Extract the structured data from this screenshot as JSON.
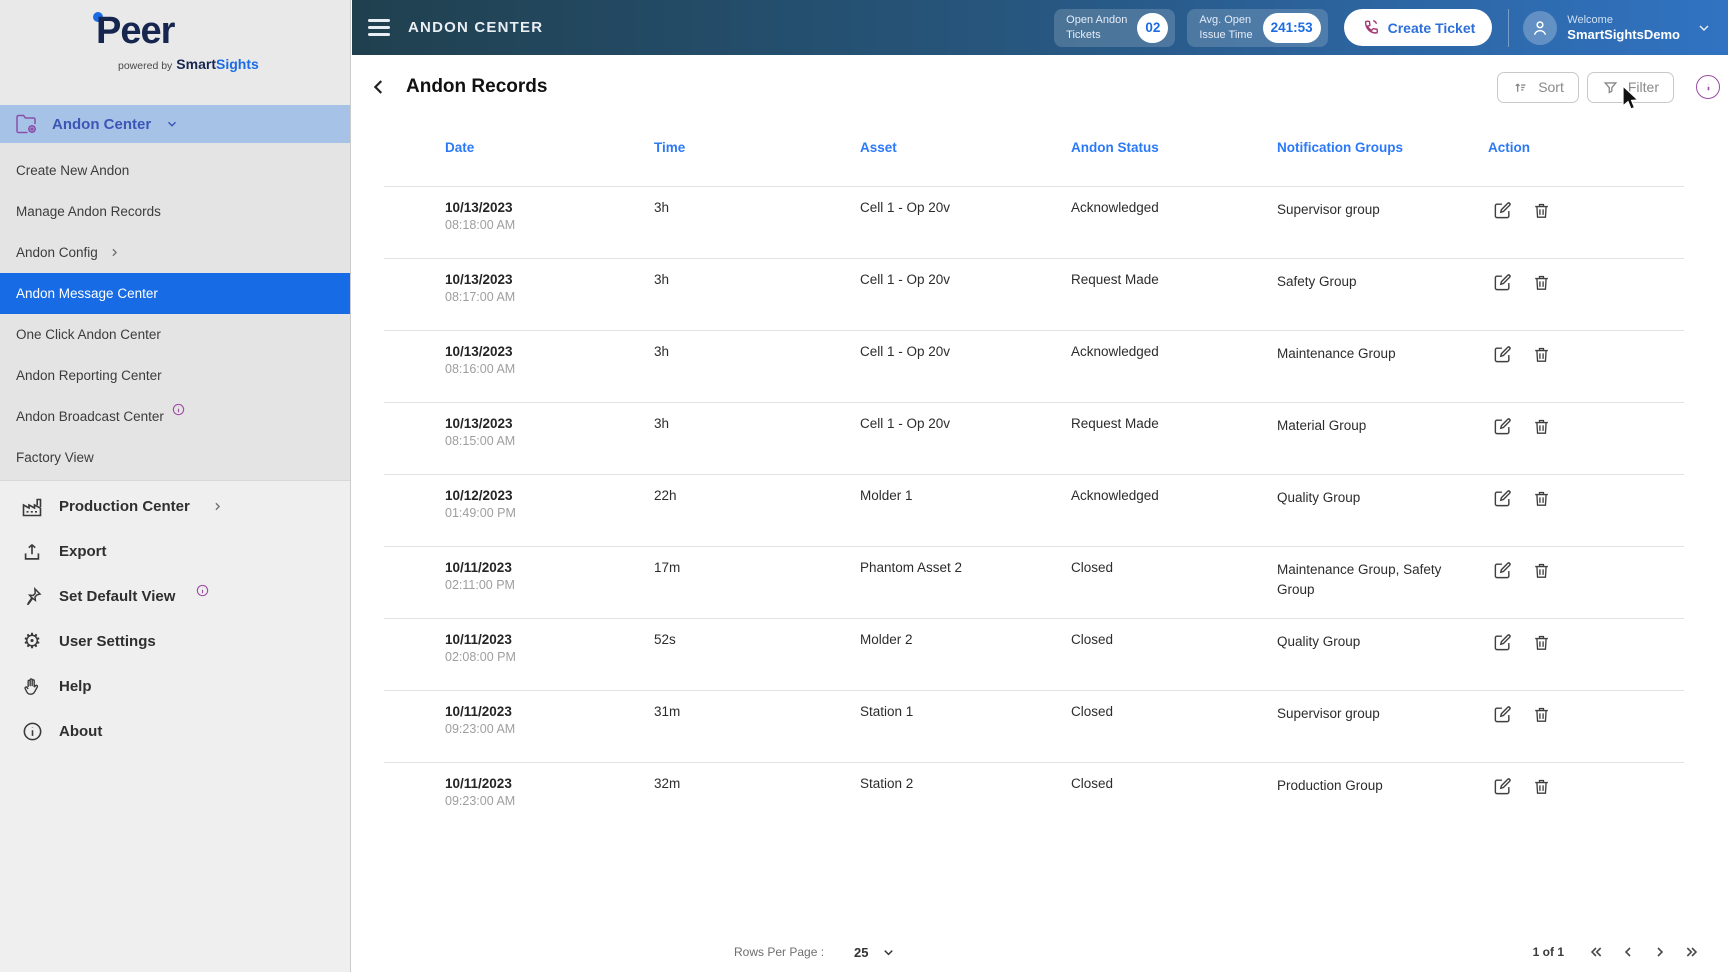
{
  "colors": {
    "accent": "#1B6CE4",
    "table-header": "#2B79F7",
    "purple": "#9C4AA4",
    "selected-nav": "#176BE4",
    "parent-nav-bg": "#A6C3E7",
    "parent-nav-text": "#3D55B4",
    "header-grad-left": "#20404E",
    "header-grad-right": "#3173C2"
  },
  "brand": {
    "name": "Peer",
    "powered_prefix": "powered by",
    "powered_bold": "Smart",
    "powered_accent": "Sights"
  },
  "sidebar": {
    "parent": {
      "label": "Andon Center",
      "icon": "folder-gear-icon"
    },
    "items": [
      {
        "label": "Create New Andon"
      },
      {
        "label": "Manage Andon Records"
      },
      {
        "label": "Andon Config",
        "chevron": true
      },
      {
        "label": "Andon Message Center",
        "selected": true
      },
      {
        "label": "One Click Andon Center"
      },
      {
        "label": "Andon Reporting Center"
      },
      {
        "label": "Andon Broadcast Center",
        "info": true
      },
      {
        "label": "Factory View"
      }
    ],
    "tools": [
      {
        "label": "Production Center",
        "icon": "factory",
        "chevron": true
      },
      {
        "label": "Export",
        "icon": "export"
      },
      {
        "label": "Set Default View",
        "icon": "pin",
        "info": true
      },
      {
        "label": "User Settings",
        "icon": "gear"
      },
      {
        "label": "Help",
        "icon": "hand"
      },
      {
        "label": "About",
        "icon": "info"
      }
    ]
  },
  "header": {
    "title": "ANDON CENTER",
    "stats": [
      {
        "label_line1": "Open Andon",
        "label_line2": "Tickets",
        "value": "02"
      },
      {
        "label_line1": "Avg. Open",
        "label_line2": "Issue Time",
        "value": "241:53"
      }
    ],
    "create_ticket_label": "Create Ticket",
    "welcome_label": "Welcome",
    "username": "SmartSightsDemo"
  },
  "page": {
    "title": "Andon Records",
    "sort_label": "Sort",
    "filter_label": "Filter"
  },
  "table": {
    "columns": [
      "Date",
      "Time",
      "Asset",
      "Andon Status",
      "Notification Groups",
      "Action"
    ],
    "rows": [
      {
        "date": "10/13/2023",
        "time_of_day": "08:18:00 AM",
        "duration": "3h",
        "asset": "Cell 1 - Op 20v",
        "status": "Acknowledged",
        "groups": "Supervisor group"
      },
      {
        "date": "10/13/2023",
        "time_of_day": "08:17:00 AM",
        "duration": "3h",
        "asset": "Cell 1 - Op 20v",
        "status": "Request Made",
        "groups": "Safety Group"
      },
      {
        "date": "10/13/2023",
        "time_of_day": "08:16:00 AM",
        "duration": "3h",
        "asset": "Cell 1 - Op 20v",
        "status": "Acknowledged",
        "groups": "Maintenance Group"
      },
      {
        "date": "10/13/2023",
        "time_of_day": "08:15:00 AM",
        "duration": "3h",
        "asset": "Cell 1 - Op 20v",
        "status": "Request Made",
        "groups": "Material Group"
      },
      {
        "date": "10/12/2023",
        "time_of_day": "01:49:00 PM",
        "duration": "22h",
        "asset": "Molder 1",
        "status": "Acknowledged",
        "groups": "Quality Group"
      },
      {
        "date": "10/11/2023",
        "time_of_day": "02:11:00 PM",
        "duration": "17m",
        "asset": "Phantom Asset 2",
        "status": "Closed",
        "groups": "Maintenance Group, Safety Group"
      },
      {
        "date": "10/11/2023",
        "time_of_day": "02:08:00 PM",
        "duration": "52s",
        "asset": "Molder 2",
        "status": "Closed",
        "groups": "Quality Group"
      },
      {
        "date": "10/11/2023",
        "time_of_day": "09:23:00 AM",
        "duration": "31m",
        "asset": "Station 1",
        "status": "Closed",
        "groups": "Supervisor group"
      },
      {
        "date": "10/11/2023",
        "time_of_day": "09:23:00 AM",
        "duration": "32m",
        "asset": "Station 2",
        "status": "Closed",
        "groups": "Production Group"
      }
    ]
  },
  "footer": {
    "rows_per_page_label": "Rows Per Page :",
    "rows_per_page_value": "25",
    "page_indicator": "1 of 1"
  }
}
